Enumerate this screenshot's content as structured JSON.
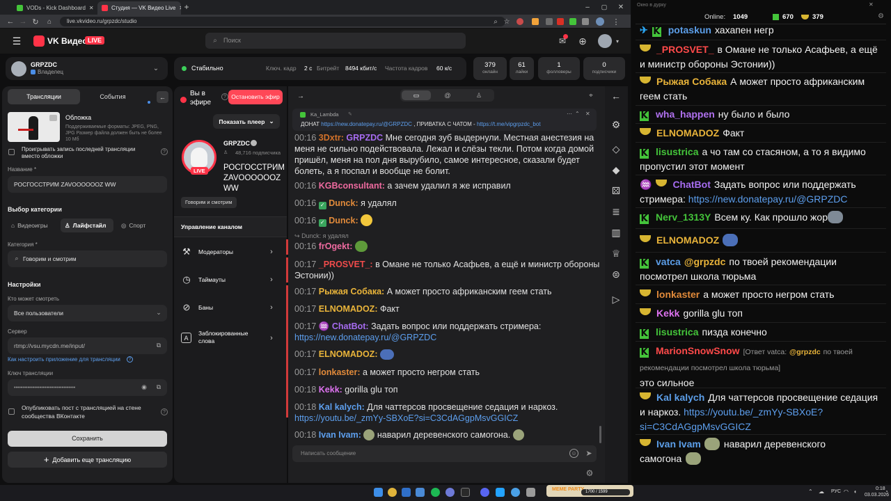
{
  "browser": {
    "tabs": [
      {
        "label": "VODs - Kick Dashboard"
      },
      {
        "label": "Студия — VK Видео Live"
      }
    ],
    "url": "live.vkvideo.ru/grpzdc/studio"
  },
  "header": {
    "logo_text": "VK Видео",
    "live_badge": "LIVE",
    "search_placeholder": "Поиск"
  },
  "channel": {
    "name": "GRPZDC",
    "role": "Владелец"
  },
  "stats": {
    "status": "Стабильно",
    "keyframe_label": "Ключ. кадр",
    "keyframe_value": "2 с",
    "bitrate_label": "Битрейт",
    "bitrate_value": "8494 кбит/с",
    "fps_label": "Частота кадров",
    "fps_value": "60 к/с",
    "cards": [
      {
        "value": "379",
        "label": "онлайн"
      },
      {
        "value": "61",
        "label": "лайки"
      },
      {
        "value": "1",
        "label": "фолловеры"
      },
      {
        "value": "0",
        "label": "подписчики"
      }
    ]
  },
  "left_panel": {
    "tab_streams": "Трансляции",
    "tab_events": "События",
    "cover_title": "Обложка",
    "cover_hint": "Поддерживаемые форматы: JPEG, PNG, JPG Размер файла должен быть не более 10 Мб",
    "play_last_label": "Проигрывать запись последней трансляции вместо обложки",
    "name_label": "Название *",
    "name_value": "РОСГОССТРИМ ZAVOOOOOOZ WW",
    "category_choice_label": "Выбор категории",
    "cat_games": "Видеоигры",
    "cat_lifestyle": "Лайфстайл",
    "cat_sport": "Спорт",
    "category_label": "Категория *",
    "category_value": "Говорим и смотрим",
    "settings_label": "Настройки",
    "who_can_watch_label": "Кто может смотреть",
    "who_can_watch_value": "Все пользователи",
    "server_label": "Сервер",
    "server_value": "rtmp://vsu.mycdn.me/input/",
    "setup_link": "Как настроить приложение для трансляции",
    "key_label": "Ключ трансляции",
    "key_value": "••••••••••••••••••••••••••••••••••••",
    "publish_post_label": "Опубликовать пост с трансляцией на стене сообщества ВКонтакте",
    "save_button": "Сохранить",
    "add_stream_button": "Добавить еще трансляцию"
  },
  "stream_panel": {
    "on_air_label": "Вы в эфире",
    "stop_button": "Остановить эфир",
    "show_player_button": "Показать плеер",
    "channel_name": "GRPZDC",
    "subscribers": "48,716 подписчика",
    "live_badge": "LIVE",
    "stream_title": "РОСГОССТРИМ ZAVOOOOOOZ WW",
    "category_tag": "Говорим и смотрим",
    "manage_title": "Управление каналом",
    "menu": [
      {
        "label": "Модераторы"
      },
      {
        "label": "Таймауты"
      },
      {
        "label": "Баны"
      },
      {
        "label": "Заблокированные слова"
      }
    ]
  },
  "chat": {
    "pinned_author": "Ka_Lambda",
    "pinned_text": "ДОНАТ",
    "pinned_link1": "https://new.donatepay.ru/@GRPZDC",
    "pinned_mid": ", ПРИВАТКА С ЧАТОМ -",
    "pinned_link2": "https://t.me/vipgrpzdc_bot",
    "input_placeholder": "Написать сообщение",
    "reply_hint": "Dunck: я удалял",
    "messages": [
      {
        "time": "00:16",
        "name": "3Dxtr:",
        "extra": "GRPZDC",
        "text": "Мне сегодня зуб выдернули. Местная анестезия на меня не сильно подействовала. Лежал и слёзы текли. Потом когда домой пришёл, меня на пол дня вырубило, самое интересное, сказали будет болеть, а я поспал и вообще не болит."
      },
      {
        "time": "00:16",
        "name": "KGBconsultant:",
        "text": "а зачем удалил я же исправил"
      },
      {
        "time": "00:16",
        "name": "Dunck:",
        "text": "я удалял"
      },
      {
        "time": "00:16",
        "name": "Dunck:",
        "text": ""
      },
      {
        "time": "00:16",
        "name": "frOgekt:",
        "text": ""
      },
      {
        "time": "00:17",
        "name": "_PROSVET_:",
        "text": "в Омане не только Асафьев, а ещё и министр обороны Эстонии))"
      },
      {
        "time": "00:17",
        "name": "Рыжая Собака:",
        "text": "А может просто африканским геем стать"
      },
      {
        "time": "00:17",
        "name": "ELNOMADOZ:",
        "text": "Факт"
      },
      {
        "time": "00:17",
        "name": "ChatBot:",
        "text": "Задать вопрос или поддержать стримера:",
        "link": "https://new.donatepay.ru/@GRPZDC"
      },
      {
        "time": "00:17",
        "name": "ELNOMADOZ:",
        "text": ""
      },
      {
        "time": "00:17",
        "name": "lonkaster:",
        "text": "а может просто негром стать"
      },
      {
        "time": "00:18",
        "name": "Kekk:",
        "text": "gorilla glu топ"
      },
      {
        "time": "00:18",
        "name": "Kal kalych:",
        "text": "Для чаттерсов просвещение седация и наркоз.",
        "link": "https://youtu.be/_zmYy-SBXoE?si=C3CdAGgpMsvGGICZ"
      },
      {
        "time": "00:18",
        "name": "Ivan Ivam:",
        "text": "наварил деревенского самогона."
      }
    ]
  },
  "overlay": {
    "title": "Окно в дурку",
    "online_label": "Online:",
    "online_value": "1049",
    "kick_count": "670",
    "vk_count": "379",
    "messages": [
      {
        "name": "potaskun",
        "text": "хахапен негр"
      },
      {
        "name": "_PROSVET_",
        "text": "в Омане не только Асафьев, а ещё и министр обороны Эстонии))"
      },
      {
        "name": "Рыжая Собака",
        "text": "А может просто африканским геем стать"
      },
      {
        "name": "wha_happen",
        "text": "ну было и было"
      },
      {
        "name": "ELNOMADOZ",
        "text": "Факт"
      },
      {
        "name": "lisustrica",
        "text": "а чо там со стасяном, а то я видимо пропустил этот момент"
      },
      {
        "name": "ChatBot",
        "text": "Задать вопрос или поддержать стримера:",
        "link": "https://new.donatepay.ru/@GRPZDC"
      },
      {
        "name": "Nerv_1313Y",
        "text": "Всем ку. Как прошло жор"
      },
      {
        "name": "ELNOMADOZ",
        "text": ""
      },
      {
        "name": "vatca",
        "mention": "@grpzdc",
        "text": "по твоей рекомендации посмотрел школа тюрьма"
      },
      {
        "name": "lonkaster",
        "text": "а может просто негром стать"
      },
      {
        "name": "Kekk",
        "text": "gorilla glu топ"
      },
      {
        "name": "lisustrica",
        "text": "пизда конечно"
      },
      {
        "name": "MarionSnowSnow",
        "reply": "[Ответ vatca:",
        "reply_mention": "@grpzdc",
        "reply_text": "по твоей рекомендации посмотрел школа тюрьма]",
        "text": "это сильное"
      },
      {
        "name": "Kal kalych",
        "text": "Для чаттерсов просвещение седация и наркоз.",
        "link": "https://youtu.be/_zmYy-SBXoE?si=C3CdAGgpMsvGGICZ"
      },
      {
        "name": "Ivan Ivam",
        "text": "наварил деревенского",
        "text2": "самогона"
      }
    ]
  },
  "taskbar": {
    "lang": "РУС",
    "time": "0:18",
    "date": "03.03.2026",
    "widget_text": "MEME PARTY",
    "widget_count": "1700 / 1599"
  },
  "colors": {
    "accent_red": "#ff3347",
    "kick_green": "#44c43a",
    "link_blue": "#5d9fee"
  }
}
